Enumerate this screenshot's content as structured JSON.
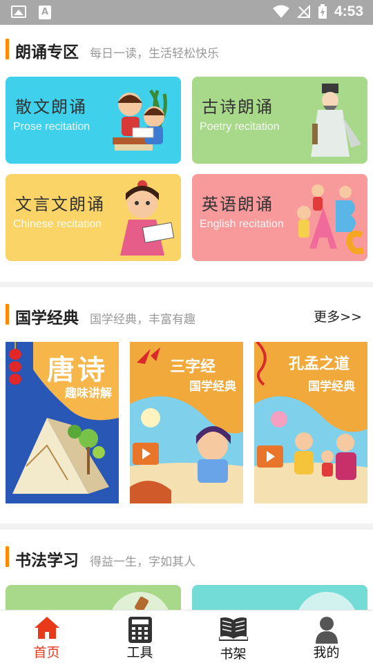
{
  "status_bar": {
    "time": "4:53"
  },
  "reading": {
    "title": "朗诵专区",
    "subtitle": "每日一读，生活轻松快乐",
    "cards": [
      {
        "cn": "散文朗诵",
        "en": "Prose recitation",
        "color": "#3fd0ec"
      },
      {
        "cn": "古诗朗诵",
        "en": "Poetry recitation",
        "color": "#a8d889"
      },
      {
        "cn": "文言文朗诵",
        "en": "Chinese recitation",
        "color": "#fbd467"
      },
      {
        "cn": "英语朗诵",
        "en": "English recitation",
        "color": "#f89a9b"
      }
    ]
  },
  "classics": {
    "title": "国学经典",
    "subtitle": "国学经典，丰富有趣",
    "more": "更多>>",
    "books": [
      {
        "title": "唐诗",
        "subtitle": "趣味讲解"
      },
      {
        "title": "三字经",
        "subtitle": "国学经典"
      },
      {
        "title": "孔孟之道",
        "subtitle": "国学经典"
      }
    ]
  },
  "calligraphy": {
    "title": "书法学习",
    "subtitle": "得益一生，字如其人"
  },
  "tabs": [
    {
      "label": "首页",
      "icon": "home-icon",
      "active": true
    },
    {
      "label": "工具",
      "icon": "calculator-icon",
      "active": false
    },
    {
      "label": "书架",
      "icon": "bookshelf-icon",
      "active": false
    },
    {
      "label": "我的",
      "icon": "profile-icon",
      "active": false
    }
  ],
  "colors": {
    "accent": "#ff8a00",
    "tab_active": "#e8391a"
  }
}
